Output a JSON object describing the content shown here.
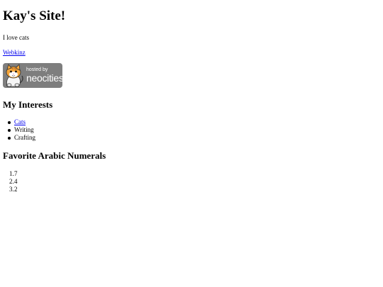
{
  "header": {
    "title": "Kay's Site!",
    "tagline": "I love cats",
    "link_label": "Webkinz"
  },
  "badge": {
    "line1": "hosted by",
    "line2": "neocities",
    "icon": "neocities-cat-logo"
  },
  "interests": {
    "heading": "My Interests",
    "items": [
      {
        "label": "Cats",
        "is_link": true
      },
      {
        "label": "Writing",
        "is_link": false
      },
      {
        "label": "Crafting",
        "is_link": false
      }
    ]
  },
  "numerals": {
    "heading": "Favorite Arabic Numerals",
    "items": [
      {
        "marker": "1.",
        "value": "7"
      },
      {
        "marker": "2.",
        "value": "4"
      },
      {
        "marker": "3.",
        "value": "2"
      }
    ]
  },
  "colors": {
    "link": "#0000ee",
    "badge_background": "#7e7e7e",
    "text": "#000000"
  }
}
